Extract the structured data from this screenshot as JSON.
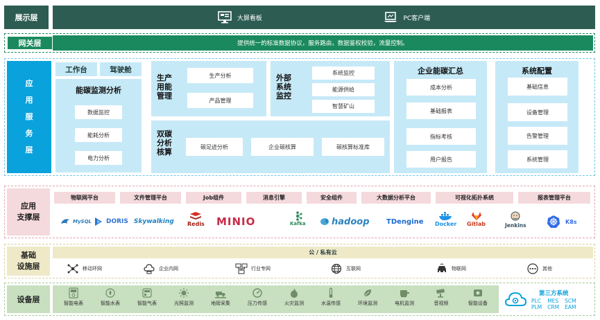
{
  "layers": {
    "display": {
      "label": "展示层",
      "items": [
        "大屏看板",
        "PC客户端"
      ]
    },
    "gateway": {
      "label": "网关层",
      "text": "提供统一的标准数据协议，服务路由，数据鉴权校验，流量控制。"
    },
    "app_service": {
      "label": "应用服务层",
      "label_chars": [
        "应",
        "用",
        "服",
        "务",
        "层"
      ],
      "workbench": "工作台",
      "cockpit": "驾驶舱",
      "monitor": {
        "title": "能碳监测分析",
        "items": [
          "数据监控",
          "能耗分析",
          "电力分析"
        ]
      },
      "production": {
        "title": [
          "生产",
          "用能",
          "管理"
        ],
        "items": [
          "生产分析",
          "产品管理"
        ]
      },
      "external": {
        "title": [
          "外部",
          "系统",
          "监控"
        ],
        "items": [
          "系统监控",
          "能源供给",
          "智慧矿山"
        ]
      },
      "carbon": {
        "title": [
          "双碳",
          "分析",
          "核算"
        ],
        "items": [
          "碳足迹分析",
          "企业碳核算",
          "碳核算标准库"
        ]
      },
      "enterprise": {
        "title": "企业能碳汇总",
        "items": [
          "成本分析",
          "基础报表",
          "指标考核",
          "用户报告"
        ]
      },
      "config": {
        "title": "系统配置",
        "items": [
          "基础信息",
          "设备管理",
          "告警管理",
          "系统管理"
        ]
      }
    },
    "support": {
      "label": [
        "应用",
        "支撑层"
      ],
      "platforms": [
        "物联网平台",
        "文件管理平台",
        "Job组件",
        "消息引擎",
        "安全组件",
        "大数据分析平台",
        "可视化拓扑系统",
        "报表管理平台"
      ],
      "logos": [
        "MySQL",
        "DORIS",
        "Skywalking",
        "Redis",
        "MINIO",
        "Kafka",
        "hadoop",
        "TDengine",
        "Docker",
        "Gitlab",
        "Jenkins",
        "K8s"
      ]
    },
    "infra": {
      "label": [
        "基础",
        "设施层"
      ],
      "cloud": "公 / 私有云",
      "networks": [
        "移动环网",
        "企业内网",
        "行业专网",
        "互联网",
        "物联网",
        "其他"
      ]
    },
    "device": {
      "label": "设备层",
      "devices": [
        "智能电表",
        "智能水表",
        "智能气表",
        "光照监测",
        "地磅采集",
        "压力传感",
        "火灾监测",
        "水温传感",
        "环境监测",
        "电机监测",
        "音视频",
        "智能设备"
      ],
      "third_party": {
        "title": "第三方系统",
        "items": [
          "PLC",
          "MES",
          "SCM",
          "PLM",
          "CRM",
          "EAM"
        ]
      }
    }
  },
  "colors": {
    "dark_green": "#2d5c52",
    "gateway_green": "#1a8a5e",
    "service_blue": "#0aa2dc",
    "light_blue": "#c6e9f7",
    "support_pink": "#f4d9dd",
    "infra_khaki": "#efe9c8",
    "device_green": "#c8dfc0"
  }
}
